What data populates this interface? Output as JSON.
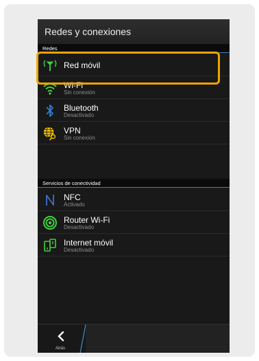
{
  "header": {
    "title": "Redes y conexiones"
  },
  "sections": [
    {
      "title": "Redes"
    },
    {
      "title": "Servicios de conectividad"
    }
  ],
  "networks": {
    "red_movil": {
      "label": "Red móvil"
    },
    "wifi": {
      "label": "Wi-Fi",
      "status": "Sin conexión"
    },
    "bluetooth": {
      "label": "Bluetooth",
      "status": "Desactivado"
    },
    "vpn": {
      "label": "VPN",
      "status": "Sin conexión"
    }
  },
  "services": {
    "nfc": {
      "label": "NFC",
      "status": "Activado"
    },
    "router": {
      "label": "Router Wi-Fi",
      "status": "Desactivado"
    },
    "internet": {
      "label": "Internet móvil",
      "status": "Desactivado"
    }
  },
  "footer": {
    "back_label": "Atrás"
  },
  "colors": {
    "accent_green": "#3fd13f",
    "bluetooth_blue": "#2f7fd6",
    "nfc_blue": "#3f6fc8",
    "highlight": "#f0a500",
    "section_line": "#3b7fb8"
  }
}
